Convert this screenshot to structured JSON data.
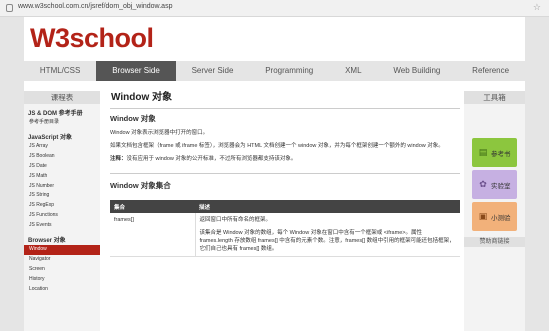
{
  "browser": {
    "url": "www.w3school.com.cn/jsref/dom_obj_window.asp"
  },
  "logo": {
    "w3": "W3",
    "rest": "school"
  },
  "nav": [
    "HTML/CSS",
    "Browser Side",
    "Server Side",
    "Programming",
    "XML",
    "Web Building",
    "Reference"
  ],
  "left": {
    "title": "课程表",
    "sections": [
      {
        "heading": "JS & DOM 参考手册",
        "items": [
          "参考手册目录"
        ]
      },
      {
        "heading": "JavaScript 对象",
        "items": [
          "JS Array",
          "JS Boolean",
          "JS Date",
          "JS Math",
          "JS Number",
          "JS String",
          "JS RegExp",
          "JS Functions",
          "JS Events"
        ]
      },
      {
        "heading": "Browser 对象",
        "items": [
          "Window",
          "Navigator",
          "Screen",
          "History",
          "Location"
        ]
      }
    ]
  },
  "main": {
    "title": "Window 对象",
    "section1": "Window 对象",
    "p1": "Window 对象表示浏览器中打开的窗口。",
    "p2": "如果文档包含框架（frame 或 iframe 标签），浏览器会为 HTML 文档创建一个 window 对象，并为每个框架创建一个额外的 window 对象。",
    "note_label": "注释：",
    "note": "没有应用于 window 对象的公开标准，不过所有浏览器都支持该对象。",
    "section2": "Window 对象集合",
    "table": {
      "headers": [
        "集合",
        "描述"
      ],
      "row": {
        "name": "frames[]",
        "desc1": "返回窗口中所有命名的框架。",
        "desc2": "该集合是 Window 对象的数组，每个 Window 对象在窗口中含有一个框架或 <iframe>。属性 frames.length 存放数组 frames[] 中含有的元素个数。注意，frames[] 数组中引用的框架可能还包括框架，它们自己也具有 frames[] 数组。"
      }
    }
  },
  "right": {
    "title": "工具箱",
    "tools": [
      "参考书",
      "实验室",
      "小测验"
    ],
    "footer": "赞助商链接"
  }
}
